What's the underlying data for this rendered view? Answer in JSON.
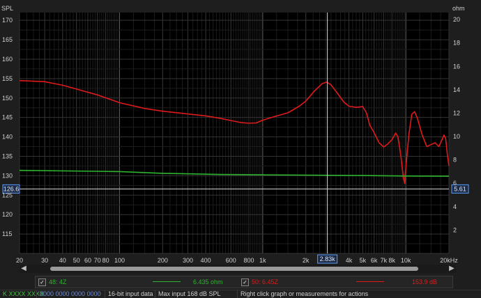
{
  "axes": {
    "left_label": "SPL",
    "right_label": "ohm",
    "left_ticks": [
      170,
      165,
      160,
      155,
      150,
      145,
      140,
      135,
      130,
      125,
      120,
      115
    ],
    "right_ticks": [
      20,
      18,
      16,
      14,
      12,
      10,
      8,
      6,
      4,
      2
    ],
    "x_ticks": [
      {
        "v": 20,
        "label": "20"
      },
      {
        "v": 30,
        "label": "30"
      },
      {
        "v": 40,
        "label": "40"
      },
      {
        "v": 50,
        "label": "50"
      },
      {
        "v": 60,
        "label": "60"
      },
      {
        "v": 70,
        "label": "70"
      },
      {
        "v": 80,
        "label": "80"
      },
      {
        "v": 100,
        "label": "100"
      },
      {
        "v": 200,
        "label": "200"
      },
      {
        "v": 300,
        "label": "300"
      },
      {
        "v": 400,
        "label": "400"
      },
      {
        "v": 600,
        "label": "600"
      },
      {
        "v": 800,
        "label": "800"
      },
      {
        "v": 1000,
        "label": "1k"
      },
      {
        "v": 2000,
        "label": "2k"
      },
      {
        "v": 4000,
        "label": "4k"
      },
      {
        "v": 5000,
        "label": "5k"
      },
      {
        "v": 6000,
        "label": "6k"
      },
      {
        "v": 7000,
        "label": "7k"
      },
      {
        "v": 8000,
        "label": "8k"
      },
      {
        "v": 10000,
        "label": "10k"
      },
      {
        "v": 20000,
        "label": "20kHz"
      }
    ]
  },
  "cursor": {
    "freq_label": "2.83k",
    "spl_label": "126.6",
    "ohm_label": "5.61",
    "freq": 2830,
    "spl": 126.6
  },
  "chart_data": {
    "type": "line",
    "x_scale": "log",
    "xlim": [
      20,
      20000
    ],
    "ylim_left": [
      110,
      172
    ],
    "ylim_right": [
      0,
      20.6
    ],
    "xlabel": "",
    "ylabel_left": "SPL",
    "ylabel_right": "ohm",
    "grid": true,
    "series": [
      {
        "name": "50: 6.45Z",
        "axis": "left",
        "color": "#e01a1a",
        "points": [
          [
            20,
            154.5
          ],
          [
            30,
            154.2
          ],
          [
            40,
            153.3
          ],
          [
            50,
            152.3
          ],
          [
            70,
            150.8
          ],
          [
            100,
            148.8
          ],
          [
            150,
            147.3
          ],
          [
            200,
            146.6
          ],
          [
            300,
            145.9
          ],
          [
            400,
            145.4
          ],
          [
            500,
            144.8
          ],
          [
            600,
            144.2
          ],
          [
            700,
            143.7
          ],
          [
            800,
            143.5
          ],
          [
            900,
            143.6
          ],
          [
            1000,
            144.3
          ],
          [
            1200,
            145.2
          ],
          [
            1500,
            146.2
          ],
          [
            1800,
            147.9
          ],
          [
            2000,
            149.2
          ],
          [
            2300,
            151.8
          ],
          [
            2600,
            153.7
          ],
          [
            2800,
            154.1
          ],
          [
            3000,
            153.4
          ],
          [
            3300,
            151.4
          ],
          [
            3700,
            148.9
          ],
          [
            4000,
            147.9
          ],
          [
            4500,
            147.6
          ],
          [
            5000,
            147.8
          ],
          [
            5300,
            146.2
          ],
          [
            5600,
            143.0
          ],
          [
            6000,
            141.1
          ],
          [
            6500,
            138.5
          ],
          [
            7000,
            137.4
          ],
          [
            7500,
            138.2
          ],
          [
            8000,
            139.3
          ],
          [
            8500,
            141.0
          ],
          [
            8800,
            140.0
          ],
          [
            9200,
            135.5
          ],
          [
            9600,
            129.7
          ],
          [
            9800,
            128.0
          ],
          [
            10000,
            132.0
          ],
          [
            10500,
            140.5
          ],
          [
            11000,
            145.8
          ],
          [
            11500,
            146.5
          ],
          [
            12000,
            145.0
          ],
          [
            13000,
            140.5
          ],
          [
            14000,
            137.5
          ],
          [
            15000,
            138.0
          ],
          [
            16000,
            138.5
          ],
          [
            17000,
            137.5
          ],
          [
            18000,
            139.5
          ],
          [
            18500,
            140.5
          ],
          [
            19000,
            139.5
          ],
          [
            19500,
            135.5
          ],
          [
            20000,
            132.5
          ]
        ]
      },
      {
        "name": "48: 4Z",
        "axis": "right",
        "color": "#2db52d",
        "points": [
          [
            20,
            7.1
          ],
          [
            100,
            7.0
          ],
          [
            200,
            6.85
          ],
          [
            500,
            6.75
          ],
          [
            1000,
            6.72
          ],
          [
            2000,
            6.7
          ],
          [
            5000,
            6.66
          ],
          [
            10000,
            6.62
          ],
          [
            20000,
            6.6
          ]
        ]
      }
    ]
  },
  "legend": [
    {
      "checked": "✓",
      "name": "48: 4Z",
      "color": "#2db52d",
      "value": "6.435 ohm"
    },
    {
      "checked": "✓",
      "name": "50: 6.45Z",
      "color": "#e01a1a",
      "value": "153.9 dB"
    }
  ],
  "statusbar": {
    "seg0": "K XXXX XXXX",
    "seg1": "0000 0000 0000 0000",
    "seg2": "16-bit input data",
    "seg3": "Max input 168 dB SPL",
    "seg4": "Right click graph or measurements for actions"
  },
  "colors": {
    "red": "#e01a1a",
    "green": "#2db52d",
    "cursor": "#5aa0ff"
  }
}
